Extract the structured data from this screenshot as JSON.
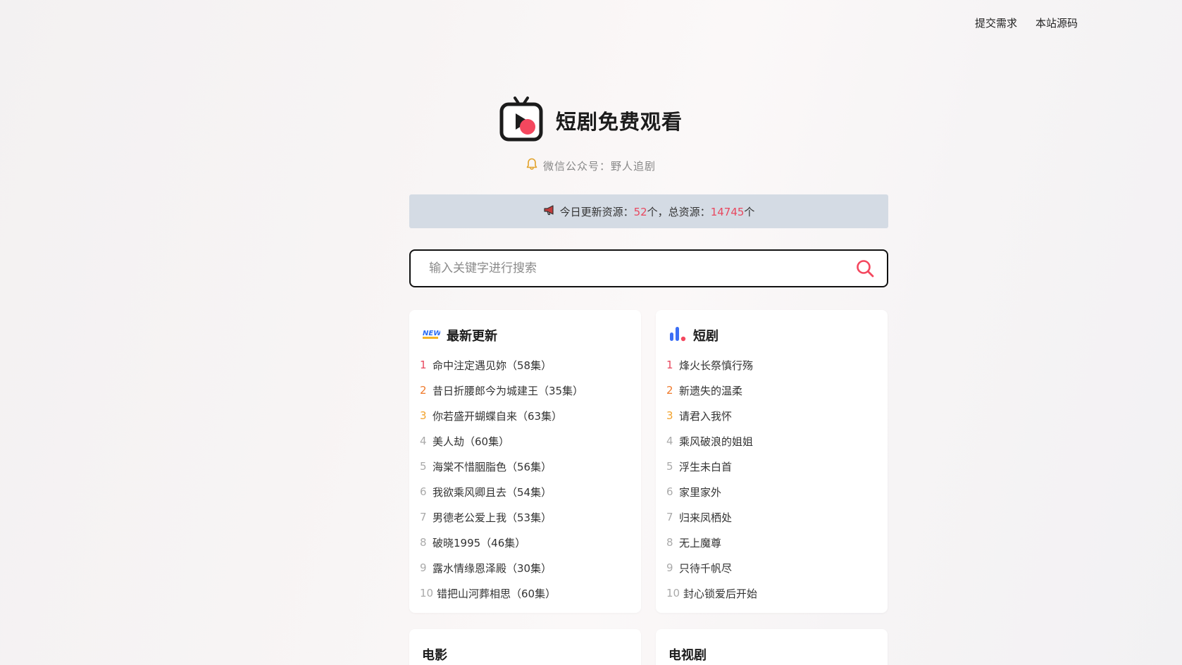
{
  "nav": {
    "links": [
      "提交需求",
      "本站源码"
    ]
  },
  "brand": {
    "title": "短剧免费观看",
    "icon": "tv-play-icon"
  },
  "subtitle": {
    "text": "微信公众号：野人追剧",
    "icon": "bell-icon"
  },
  "notice": {
    "icon": "megaphone-icon",
    "prefix": "今日更新资源：",
    "today": "52",
    "middle": "个，总资源：",
    "total": "14745",
    "suffix": "个"
  },
  "search": {
    "placeholder": "输入关键字进行搜索",
    "value": "",
    "icon": "search-icon"
  },
  "colors": {
    "accent": "#e8485f",
    "rank1": "#e8485f",
    "rank2": "#f07a2b",
    "rank3": "#f2a22c",
    "rank_other": "#aaaaaa",
    "notice_bg": "#d4dbe4"
  },
  "cards": [
    {
      "title": "最新更新",
      "icon": "new-badge-icon",
      "items": [
        "命中注定遇见妳（58集）",
        "昔日折腰郎今为城建王（35集）",
        "你若盛开蝴蝶自来（63集）",
        "美人劫（60集）",
        "海棠不惜胭脂色（56集）",
        "我欲乘风卿且去（54集）",
        "男德老公爱上我（53集）",
        "破晓1995（46集）",
        "露水情缘恩泽殿（30集）",
        "错把山河葬相思（60集）"
      ]
    },
    {
      "title": "短剧",
      "icon": "bar-chart-icon",
      "items": [
        "烽火长祭慎行殇",
        "新遗失的温柔",
        "请君入我怀",
        "乘风破浪的姐姐",
        "浮生未白首",
        "家里家外",
        "归来凤栖处",
        "无上魔尊",
        "只待千帆尽",
        "封心锁爱后开始"
      ]
    },
    {
      "title": "电影"
    },
    {
      "title": "电视剧"
    }
  ]
}
